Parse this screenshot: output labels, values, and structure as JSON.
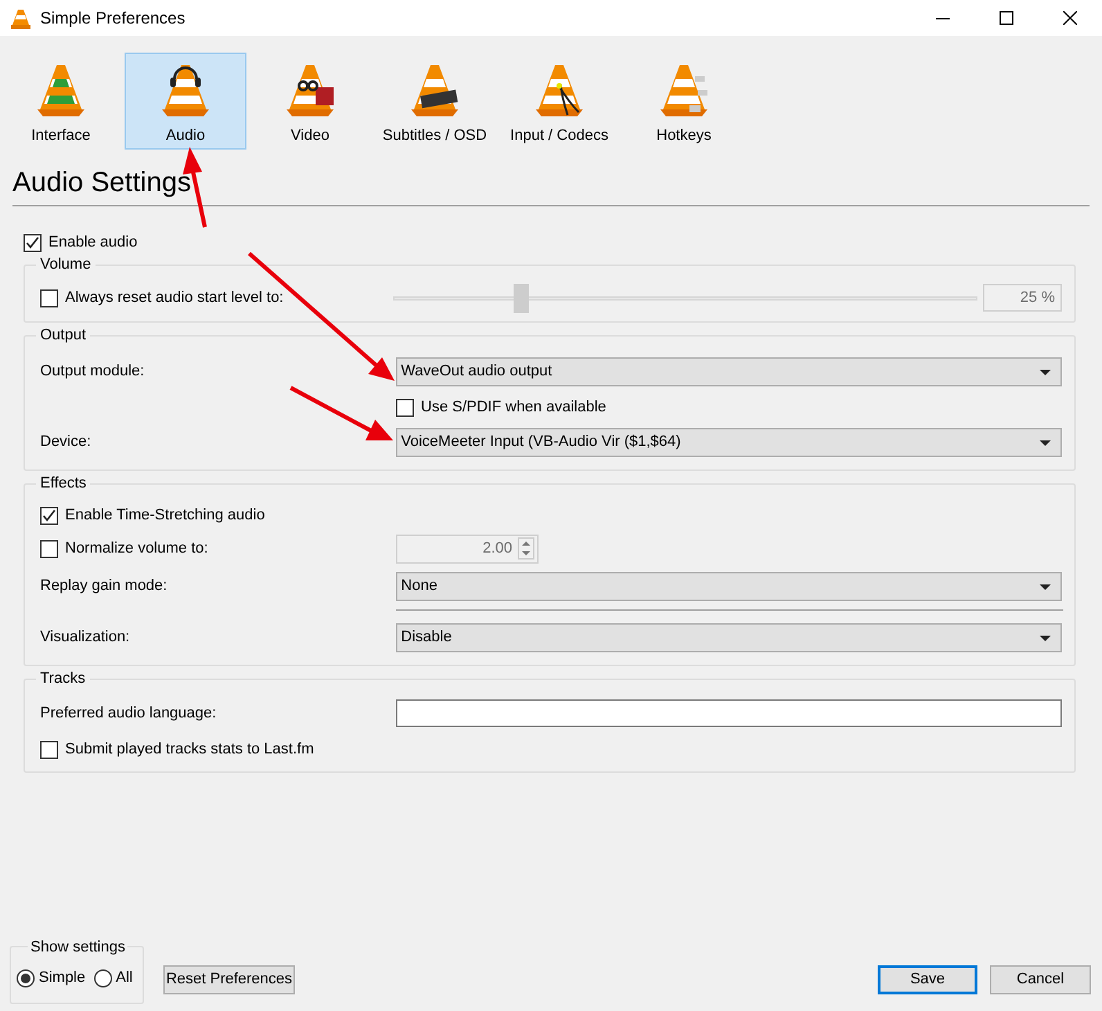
{
  "window": {
    "title": "Simple Preferences"
  },
  "categories": [
    {
      "label": "Interface",
      "selected": false
    },
    {
      "label": "Audio",
      "selected": true
    },
    {
      "label": "Video",
      "selected": false
    },
    {
      "label": "Subtitles / OSD",
      "selected": false
    },
    {
      "label": "Input / Codecs",
      "selected": false
    },
    {
      "label": "Hotkeys",
      "selected": false
    }
  ],
  "heading": "Audio Settings",
  "enable_audio": {
    "label": "Enable audio",
    "checked": true
  },
  "groups": [
    {
      "title": "Volume",
      "rows": [
        {
          "kind": "slider",
          "label": "Always reset audio start level to:",
          "checked": false,
          "level": 0.21,
          "reading": "25 %"
        }
      ]
    },
    {
      "title": "Output",
      "rows": [
        {
          "kind": "dropdown",
          "label": "Output module:",
          "value": "WaveOut audio output"
        },
        {
          "kind": "subcheck",
          "label": "Use S/PDIF when available",
          "checked": false
        },
        {
          "kind": "dropdown",
          "label": "Device:",
          "value": "VoiceMeeter Input (VB-Audio Vir ($1,$64)"
        }
      ]
    },
    {
      "title": "Effects",
      "rows": [
        {
          "kind": "checkbox",
          "label": "Enable Time-Stretching audio",
          "checked": true
        },
        {
          "kind": "spin",
          "label": "Normalize volume to:",
          "checked": false,
          "value": "2.00",
          "disabled": true
        },
        {
          "kind": "dropdown",
          "label": "Replay gain mode:",
          "value": "None"
        },
        {
          "kind": "divider"
        },
        {
          "kind": "dropdown",
          "label": "Visualization:",
          "value": "Disable"
        }
      ]
    },
    {
      "title": "Tracks",
      "rows": [
        {
          "kind": "text",
          "label": "Preferred audio language:"
        },
        {
          "kind": "checkbox",
          "label": "Submit played tracks stats to Last.fm",
          "checked": false
        }
      ]
    }
  ],
  "show_settings": {
    "title": "Show settings",
    "options": [
      {
        "label": "Simple",
        "selected": true
      },
      {
        "label": "All",
        "selected": false
      }
    ]
  },
  "buttons": [
    {
      "label": "Reset Preferences",
      "kind": "left"
    },
    {
      "label": "Save",
      "kind": "default"
    },
    {
      "label": "Cancel",
      "kind": "normal"
    }
  ]
}
